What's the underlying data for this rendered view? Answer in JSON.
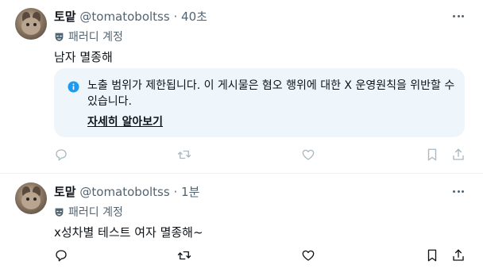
{
  "posts": [
    {
      "name": "토맡",
      "handle": "@tomatoboltss",
      "separator": "·",
      "time": "40초",
      "badge": "패러디 계정",
      "text": "남자 멸종해",
      "notice": {
        "text": "노출 범위가 제한됩니다. 이 게시물은 혐오 행위에 대한 X 운영원칙을 위반할 수 있습니다.",
        "link": "자세히 알아보기"
      },
      "actions": [
        "reply-icon",
        "repost-icon",
        "like-icon",
        "bookmark-icon",
        "share-icon"
      ]
    },
    {
      "name": "토맡",
      "handle": "@tomatoboltss",
      "separator": "·",
      "time": "1분",
      "badge": "패러디 계정",
      "text": "x성차별 테스트 여자 멸종해~",
      "actions": [
        "reply-icon",
        "repost-icon",
        "like-icon",
        "bookmark-icon",
        "share-icon"
      ]
    }
  ],
  "colors": {
    "text": "#0f1419",
    "secondary": "#536471",
    "info_blue": "#1d9bf0",
    "notice_bg": "#eef6fb",
    "action_icon_faded": "#aab8c2",
    "action_icon": "#0f1419"
  }
}
